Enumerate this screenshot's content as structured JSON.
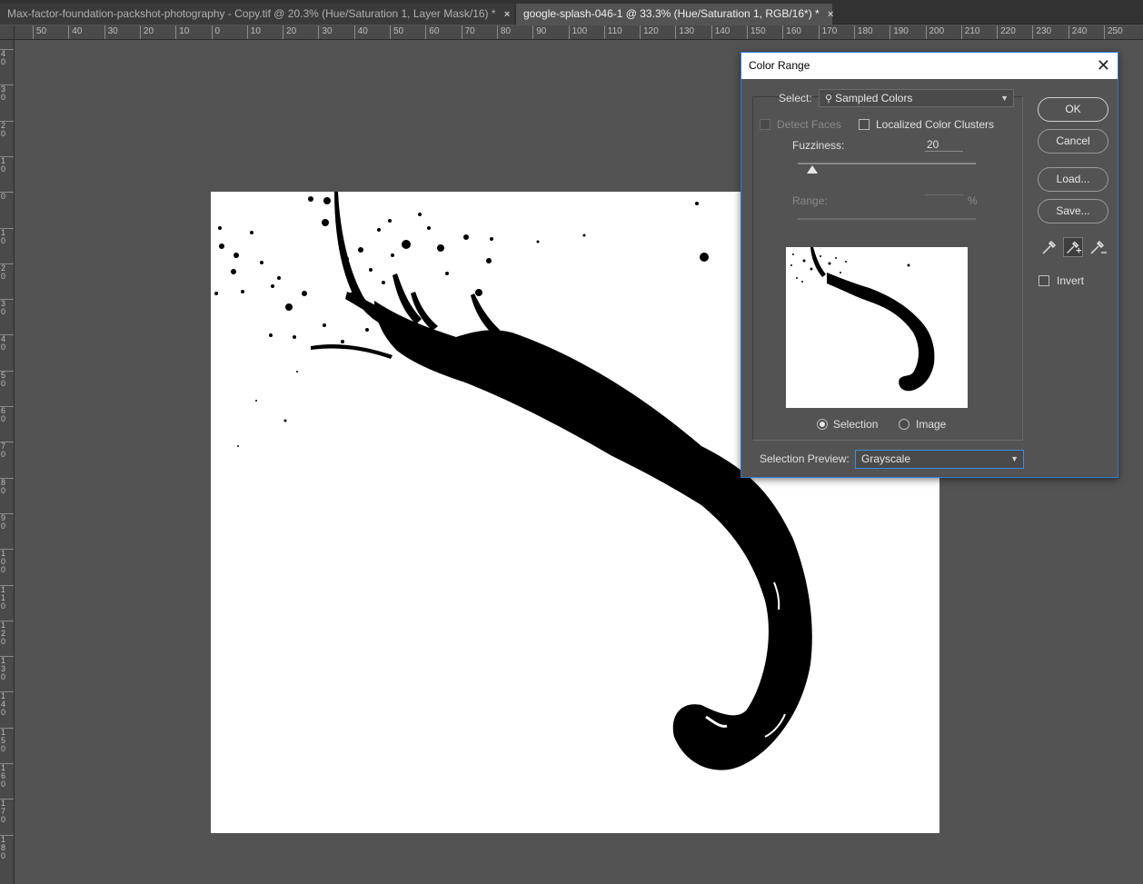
{
  "tabs": [
    {
      "label": "Max-factor-foundation-packshot-photography - Copy.tif @ 20.3% (Hue/Saturation 1, Layer Mask/16) *",
      "close": "×"
    },
    {
      "label": "google-splash-046-1 @ 33.3% (Hue/Saturation 1, RGB/16*) *",
      "close": "×"
    }
  ],
  "ruler": {
    "h_labels": [
      "50",
      "40",
      "30",
      "20",
      "10",
      "0",
      "10",
      "20",
      "30",
      "40",
      "50",
      "60",
      "70",
      "80",
      "90",
      "100",
      "110",
      "120",
      "130",
      "140",
      "150",
      "160",
      "170",
      "180",
      "190",
      "200",
      "210",
      "220",
      "230",
      "240",
      "250"
    ],
    "v_labels": [
      "4\n0",
      "3\n0",
      "2\n0",
      "1\n0",
      "0",
      "1\n0",
      "2\n0",
      "3\n0",
      "4\n0",
      "5\n0",
      "6\n0",
      "7\n0",
      "8\n0",
      "9\n0",
      "1\n0\n0",
      "1\n1\n0",
      "1\n2\n0",
      "1\n3\n0",
      "1\n4\n0",
      "1\n5\n0",
      "1\n6\n0",
      "1\n7\n0",
      "1\n8\n0"
    ]
  },
  "dialog": {
    "title": "Color Range",
    "close": "✕",
    "select_label": "Select:",
    "select_value": "Sampled Colors",
    "detect_faces": "Detect Faces",
    "localized": "Localized Color Clusters",
    "fuzziness_label": "Fuzziness:",
    "fuzziness_value": "20",
    "fuzziness_level": 0.08,
    "range_label": "Range:",
    "range_unit": "%",
    "radio_selection": "Selection",
    "radio_image": "Image",
    "preview_label": "Selection Preview:",
    "preview_value": "Grayscale",
    "buttons": {
      "ok": "OK",
      "cancel": "Cancel",
      "load": "Load...",
      "save": "Save..."
    },
    "invert": "Invert",
    "icons": [
      "eyedropper-icon",
      "eyedropper-plus-icon",
      "eyedropper-minus-icon"
    ]
  }
}
